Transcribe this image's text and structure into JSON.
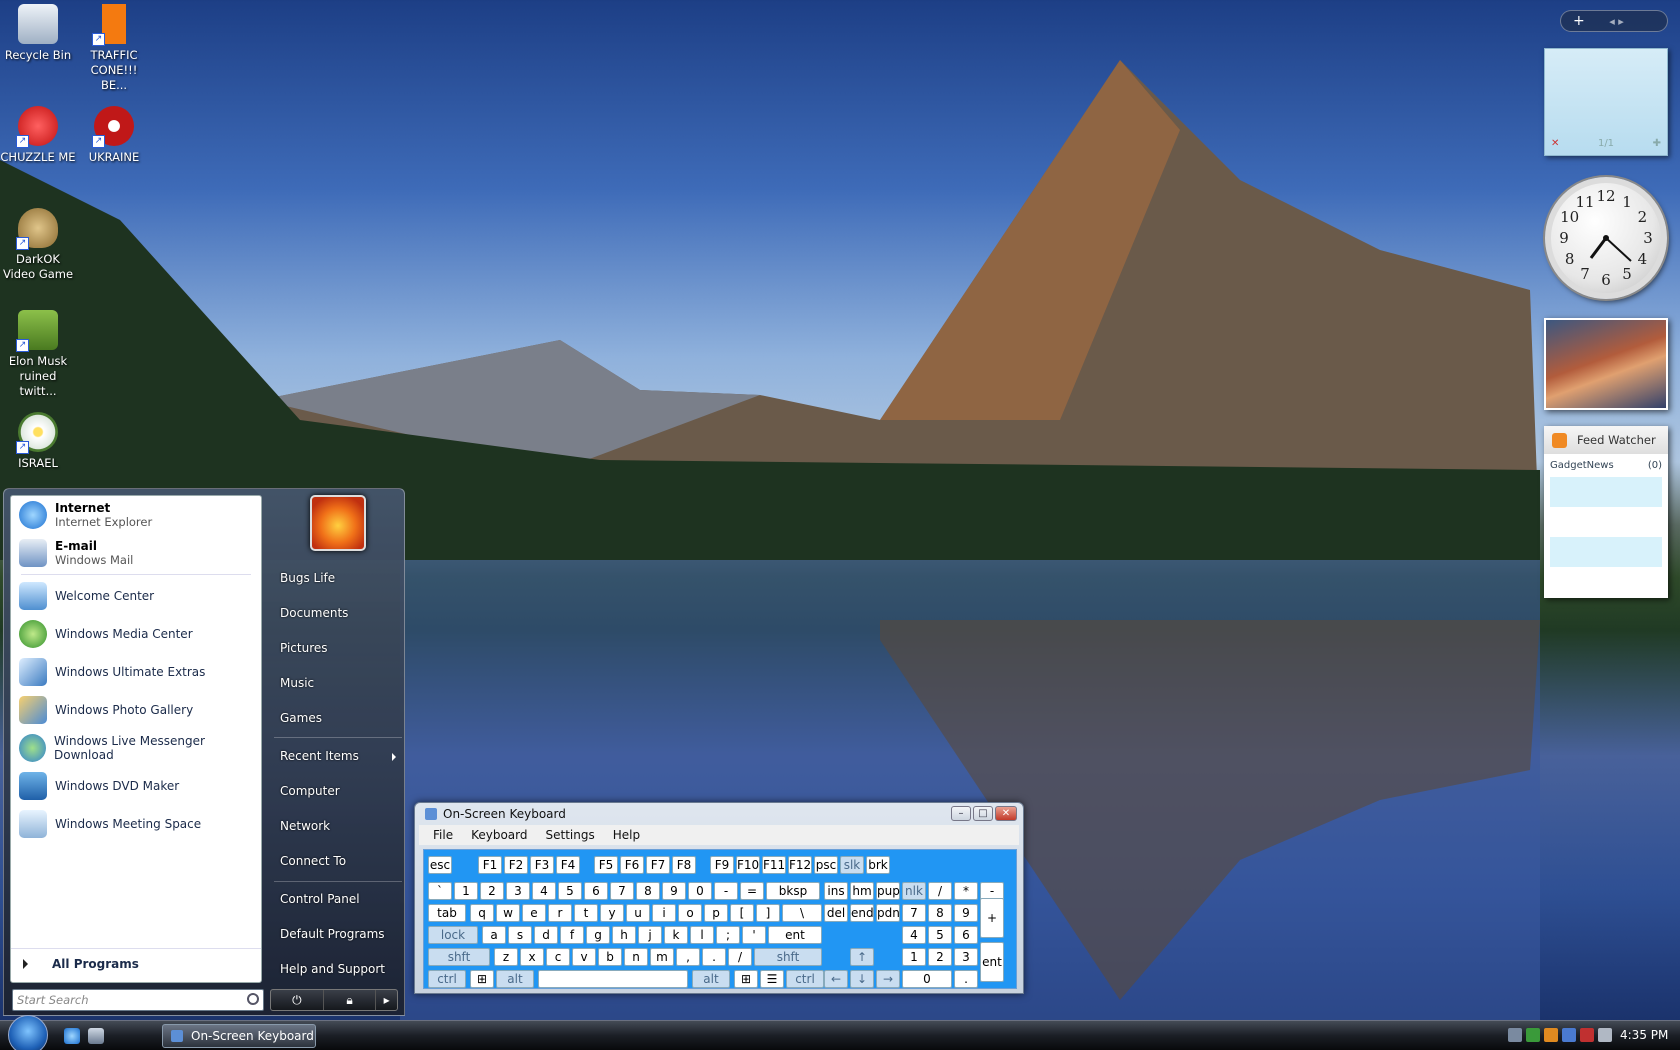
{
  "desktop": {
    "icons": [
      {
        "label": "Recycle Bin",
        "icon": "recycle-bin-icon"
      },
      {
        "label": "TRAFFIC CONE!!! BE...",
        "icon": "traffic-cone-icon"
      },
      {
        "label": "CHUZZLE ME",
        "icon": "chuzzle-icon"
      },
      {
        "label": "UKRAINE",
        "icon": "radiation-icon"
      },
      {
        "label": "DarkOK Video Game",
        "icon": "money-bag-icon"
      },
      {
        "label": "Elon Musk ruined twitt...",
        "icon": "box-game-icon"
      },
      {
        "label": "ISRAEL",
        "icon": "flower-icon"
      }
    ]
  },
  "gadgets": {
    "bar_add": "+",
    "bar_nav": "◂ ▸",
    "note_page": "1/1",
    "clock_numbers": [
      "12",
      "1",
      "2",
      "3",
      "4",
      "5",
      "6",
      "7",
      "8",
      "9",
      "10",
      "11"
    ],
    "feed_title": "Feed Watcher",
    "feed_source": "GadgetNews",
    "feed_count": "(0)"
  },
  "start_menu": {
    "pinned": [
      {
        "title": "Internet",
        "sub": "Internet Explorer"
      },
      {
        "title": "E-mail",
        "sub": "Windows Mail"
      }
    ],
    "programs": [
      "Welcome Center",
      "Windows Media Center",
      "Windows Ultimate Extras",
      "Windows Photo Gallery",
      "Windows Live Messenger Download",
      "Windows DVD Maker",
      "Windows Meeting Space"
    ],
    "all_programs": "All Programs",
    "right": [
      "Bugs Life",
      "Documents",
      "Pictures",
      "Music",
      "Games",
      "Recent Items",
      "Computer",
      "Network",
      "Connect To",
      "Control Panel",
      "Default Programs",
      "Help and Support"
    ],
    "search_placeholder": "Start Search"
  },
  "osk": {
    "title": "On-Screen Keyboard",
    "menu": [
      "File",
      "Keyboard",
      "Settings",
      "Help"
    ]
  },
  "taskbar": {
    "task_label": "On-Screen Keyboard",
    "time": "4:35 PM"
  },
  "colors": {
    "keyboard_bg": "#2196f3",
    "accent": "#1d5fb5"
  }
}
